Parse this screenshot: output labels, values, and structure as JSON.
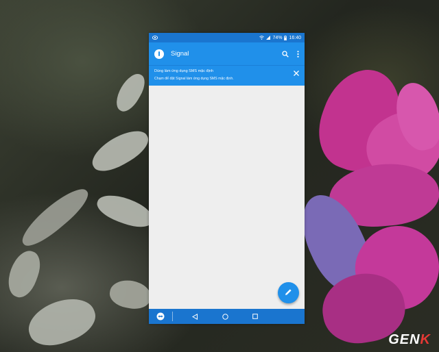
{
  "status_bar": {
    "battery": "74%",
    "time": "16:40"
  },
  "app_bar": {
    "title": "Signal"
  },
  "banner": {
    "title": "Dùng làm ứng dụng SMS mặc định",
    "subtitle": "Chạm để đặt Signal làm ứng dụng SMS mặc định."
  },
  "fab": {
    "icon": "pencil-icon"
  },
  "nav": {
    "app_icon": "teamviewer-icon",
    "buttons": [
      "back-icon",
      "home-icon",
      "recents-icon"
    ]
  },
  "watermark": {
    "text_main": "GEN",
    "text_accent": "K"
  },
  "colors": {
    "primary": "#2090ea",
    "primary_dark": "#1a75cf",
    "background": "#eeeeee"
  }
}
